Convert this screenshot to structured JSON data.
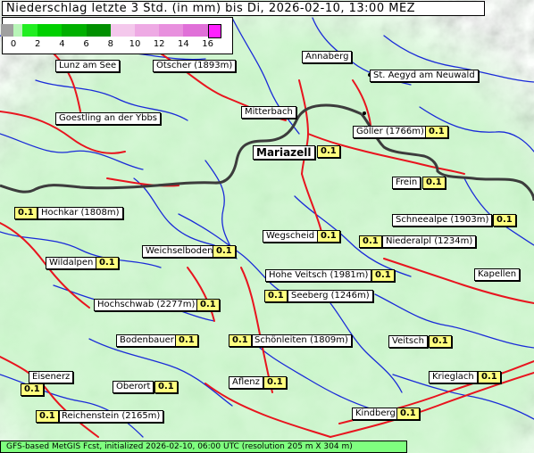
{
  "title": "Niederschlag letzte 3 Std. (in mm) bis Di, 2026-02-10, 13:00 MEZ",
  "legend": {
    "ticks": [
      "0",
      "2",
      "4",
      "6",
      "8",
      "10",
      "12",
      "14",
      "16"
    ],
    "colors": [
      "#a0a0a0",
      "#90ee90",
      "#00c000",
      "#00a000",
      "#008000",
      "#f0b8e8",
      "#e898e0",
      "#e070d8",
      "#ff00ff"
    ]
  },
  "places": [
    {
      "id": "lunz",
      "name": "Lunz am See"
    },
    {
      "id": "oetscher",
      "name": "Ötscher (1893m)"
    },
    {
      "id": "annaberg",
      "name": "Annaberg"
    },
    {
      "id": "st-aegyd",
      "name": "St. Aegyd am Neuwald"
    },
    {
      "id": "goestling",
      "name": "Goestling an der Ybbs"
    },
    {
      "id": "mitterbach",
      "name": "Mitterbach"
    },
    {
      "id": "goeller",
      "name": "Göller (1766m)",
      "value": "0.1"
    },
    {
      "id": "mariazell",
      "name": "Mariazell",
      "value": "0.1"
    },
    {
      "id": "frein",
      "name": "Frein",
      "value": "0.1"
    },
    {
      "id": "hochkar",
      "name": "Hochkar (1808m)",
      "value": "0.1"
    },
    {
      "id": "schneealpe",
      "name": "Schneealpe (1903m)",
      "value": "0.1"
    },
    {
      "id": "wegscheid",
      "name": "Wegscheid",
      "value": "0.1"
    },
    {
      "id": "niederalpl",
      "name": "Niederalpl (1234m)",
      "value": "0.1"
    },
    {
      "id": "weichselboden",
      "name": "Weichselboden",
      "value": "0.1"
    },
    {
      "id": "wildalpen",
      "name": "Wildalpen",
      "value": "0.1"
    },
    {
      "id": "hohe-veitsch",
      "name": "Hohe Veitsch (1981m)",
      "value": "0.1"
    },
    {
      "id": "kapellen",
      "name": "Kapellen"
    },
    {
      "id": "seeberg",
      "name": "Seeberg (1246m)",
      "value": "0.1"
    },
    {
      "id": "hochschwab",
      "name": "Hochschwab (2277m)",
      "value": "0.1"
    },
    {
      "id": "bodenbauer",
      "name": "Bodenbauer",
      "value": "0.1"
    },
    {
      "id": "schoenleiten",
      "name": "Schönleiten (1809m)",
      "value": "0.1"
    },
    {
      "id": "veitsch",
      "name": "Veitsch",
      "value": "0.1"
    },
    {
      "id": "eisenerz",
      "name": "Eisenerz",
      "value": "0.1"
    },
    {
      "id": "oberort",
      "name": "Oberort",
      "value": "0.1"
    },
    {
      "id": "aflenz",
      "name": "Aflenz",
      "value": "0.1"
    },
    {
      "id": "krieglach",
      "name": "Krieglach",
      "value": "0.1"
    },
    {
      "id": "reichenstein",
      "name": "Reichenstein (2165m)",
      "value": "0.1"
    },
    {
      "id": "kindberg",
      "name": "Kindberg",
      "value": "0.1"
    }
  ],
  "footer": "GFS-based MetGIS Fcst, initialized 2026-02-10, 06:00 UTC  (resolution 205 m X 304 m)"
}
